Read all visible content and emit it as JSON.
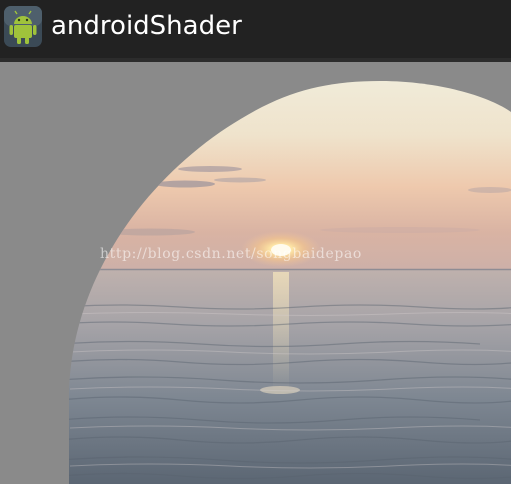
{
  "action_bar": {
    "title": "androidShader",
    "icon": "android-robot-icon"
  },
  "content": {
    "image": "sunset-over-sea",
    "shape": "rounded-arc-shader",
    "watermark": "http://blog.csdn.net/songbaidepao"
  },
  "colors": {
    "action_bar_bg": "#222222",
    "content_bg": "#8a8a8a",
    "title_text": "#ffffff"
  }
}
